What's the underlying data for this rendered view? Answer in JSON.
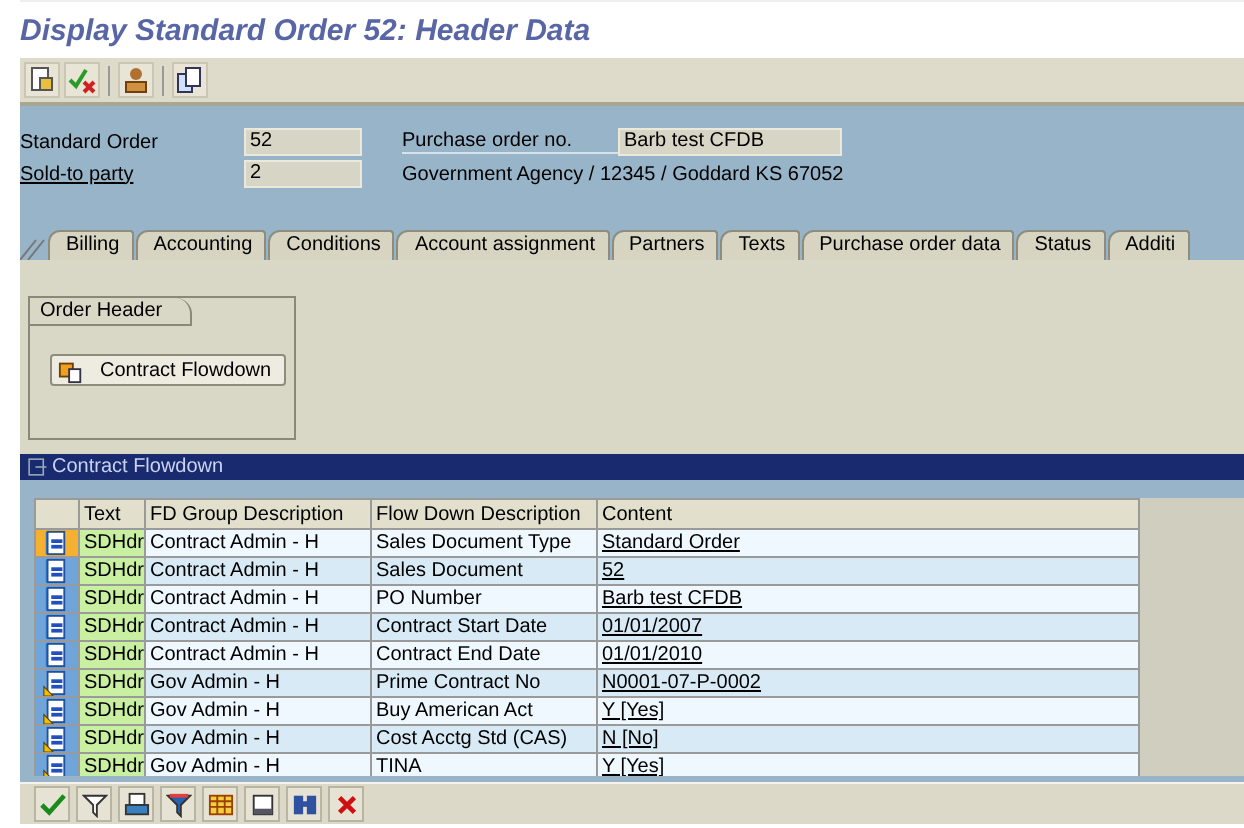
{
  "window": {
    "title": "Display Standard Order 52: Header Data"
  },
  "header": {
    "fields": [
      {
        "label": "Standard Order",
        "link": false,
        "value": "52"
      },
      {
        "label": "Sold-to party",
        "link": true,
        "value": "2"
      }
    ],
    "po_label": "Purchase order no.",
    "po_value": "Barb test CFDB",
    "sold_to_text": "Government Agency / 12345 / Goddard KS 67052"
  },
  "tabs": [
    {
      "label": "Billing",
      "selected": false
    },
    {
      "label": "Accounting",
      "selected": false
    },
    {
      "label": "Conditions",
      "selected": false
    },
    {
      "label": "Account assignment",
      "selected": false
    },
    {
      "label": "Partners",
      "selected": false
    },
    {
      "label": "Texts",
      "selected": false
    },
    {
      "label": "Purchase order data",
      "selected": false
    },
    {
      "label": "Status",
      "selected": false
    },
    {
      "label": "Additi",
      "selected": false
    }
  ],
  "order_header": {
    "title": "Order Header",
    "button": "Contract Flowdown"
  },
  "grid": {
    "title": "Contract Flowdown",
    "columns": [
      "Text",
      "FD Group Description",
      "Flow Down Description",
      "Content"
    ],
    "rows": [
      {
        "kind": "doc",
        "selected": true,
        "text": "SDHdr",
        "group": "Contract Admin - H",
        "description": "Sales Document Type",
        "content": "Standard Order"
      },
      {
        "kind": "doc",
        "selected": false,
        "text": "SDHdr",
        "group": "Contract Admin - H",
        "description": "Sales Document",
        "content": "52"
      },
      {
        "kind": "doc",
        "selected": false,
        "text": "SDHdr",
        "group": "Contract Admin - H",
        "description": "PO Number",
        "content": "Barb test CFDB"
      },
      {
        "kind": "doc",
        "selected": false,
        "text": "SDHdr",
        "group": "Contract Admin - H",
        "description": "Contract Start Date",
        "content": "01/01/2007"
      },
      {
        "kind": "doc",
        "selected": false,
        "text": "SDHdr",
        "group": "Contract Admin - H",
        "description": "Contract End Date",
        "content": "01/01/2010"
      },
      {
        "kind": "doc-marked",
        "selected": false,
        "text": "SDHdr",
        "group": "Gov Admin - H",
        "description": "Prime Contract No",
        "content": "N0001-07-P-0002"
      },
      {
        "kind": "doc-marked",
        "selected": false,
        "text": "SDHdr",
        "group": "Gov Admin - H",
        "description": "Buy American Act",
        "content": "Y  [Yes]"
      },
      {
        "kind": "doc-marked",
        "selected": false,
        "text": "SDHdr",
        "group": "Gov Admin - H",
        "description": "Cost Acctg Std (CAS)",
        "content": "N  [No]"
      },
      {
        "kind": "doc-marked",
        "selected": false,
        "text": "SDHdr",
        "group": "Gov Admin - H",
        "description": "TINA",
        "content": "Y  [Yes]"
      }
    ]
  }
}
